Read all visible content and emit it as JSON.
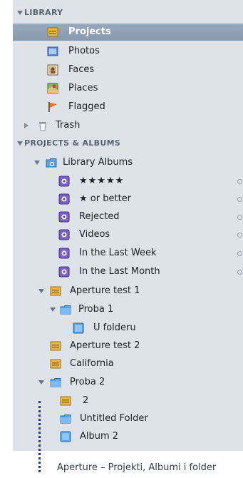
{
  "library": {
    "header": "LIBRARY",
    "items": [
      {
        "label": "Projects",
        "icon": "projects-icon",
        "selected": true
      },
      {
        "label": "Photos",
        "icon": "photos-icon"
      },
      {
        "label": "Faces",
        "icon": "faces-icon"
      },
      {
        "label": "Places",
        "icon": "places-icon"
      },
      {
        "label": "Flagged",
        "icon": "flag-icon"
      },
      {
        "label": "Trash",
        "icon": "trash-icon"
      }
    ]
  },
  "projects_albums": {
    "header": "PROJECTS & ALBUMS",
    "library_albums": "Library Albums",
    "smart_albums": [
      "★★★★★",
      "★ or better",
      "Rejected",
      "Videos",
      "In the Last Week",
      "In the Last Month"
    ],
    "aperture_test_1": "Aperture test 1",
    "proba_1": "Proba 1",
    "u_folderu": "U folderu",
    "aperture_test_2": "Aperture test 2",
    "california": "California",
    "proba_2": "Proba 2",
    "item_2": "2",
    "untitled_folder": "Untitled Folder",
    "album_2": "Album 2"
  },
  "caption": "Aperture – Projekti, Albumi i folder"
}
